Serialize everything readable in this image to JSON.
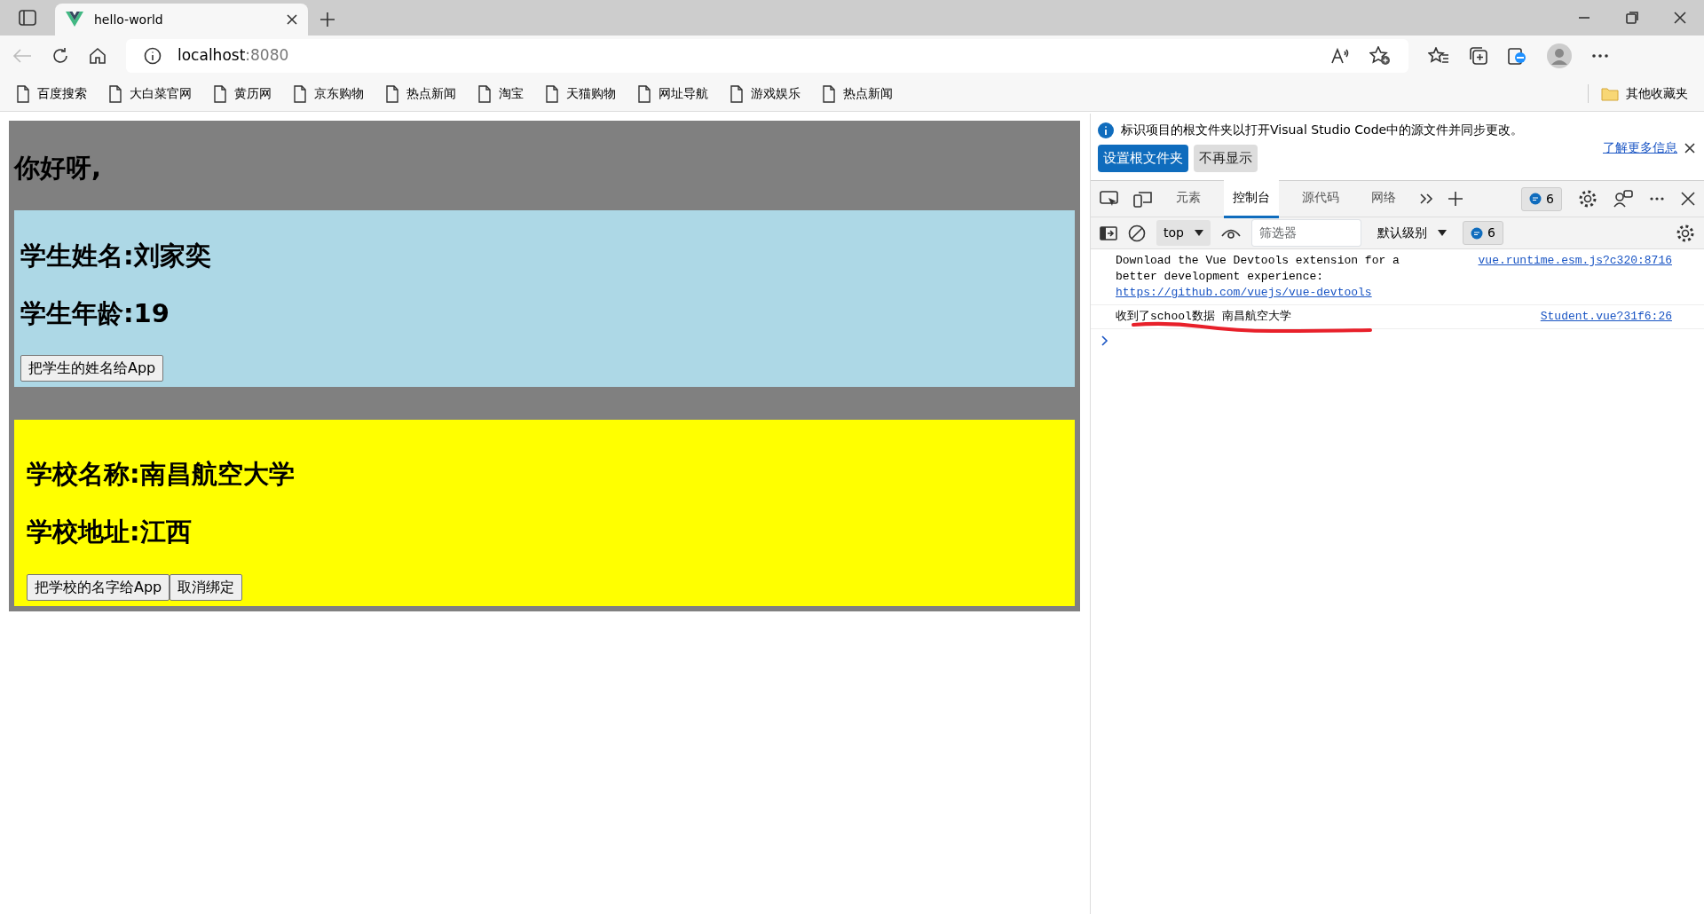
{
  "browser": {
    "tab": {
      "title": "hello-world"
    },
    "address": {
      "host": "localhost",
      "port": ":8080"
    },
    "bookmarks": [
      "百度搜索",
      "大白菜官网",
      "黄历网",
      "京东购物",
      "热点新闻",
      "淘宝",
      "天猫购物",
      "网址导航",
      "游戏娱乐",
      "热点新闻"
    ],
    "other_bookmarks": "其他收藏夹"
  },
  "app": {
    "greeting": "你好呀,",
    "student": {
      "name_line": "学生姓名:刘家奕",
      "age_line": "学生年龄:19",
      "buttons": [
        "把学生的姓名给App"
      ]
    },
    "school": {
      "name_line": "学校名称:南昌航空大学",
      "address_line": "学校地址:江西",
      "buttons": [
        "把学校的名字给App",
        "取消绑定"
      ]
    }
  },
  "devtools": {
    "notice": {
      "text": "标识项目的根文件夹以打开Visual Studio Code中的源文件并同步更改。",
      "link": "了解更多信息",
      "buttons": [
        "设置根文件夹",
        "不再显示"
      ]
    },
    "tabs": [
      {
        "label": "元素",
        "selected": false
      },
      {
        "label": "控制台",
        "selected": true
      },
      {
        "label": "源代码",
        "selected": false
      },
      {
        "label": "网络",
        "selected": false
      }
    ],
    "issues_count": "6",
    "toolbar": {
      "context": "top",
      "filter_placeholder": "筛选器",
      "level": "默认级别",
      "count": "6"
    },
    "messages": [
      {
        "text": "Download the Vue Devtools extension for a better development experience:",
        "link": "https://github.com/vuejs/vue-devtools",
        "source": "vue.runtime.esm.js?c320:8716",
        "underlined": false
      },
      {
        "text": "收到了school数据 南昌航空大学",
        "source": "Student.vue?31f6:26",
        "underlined": true
      }
    ]
  }
}
